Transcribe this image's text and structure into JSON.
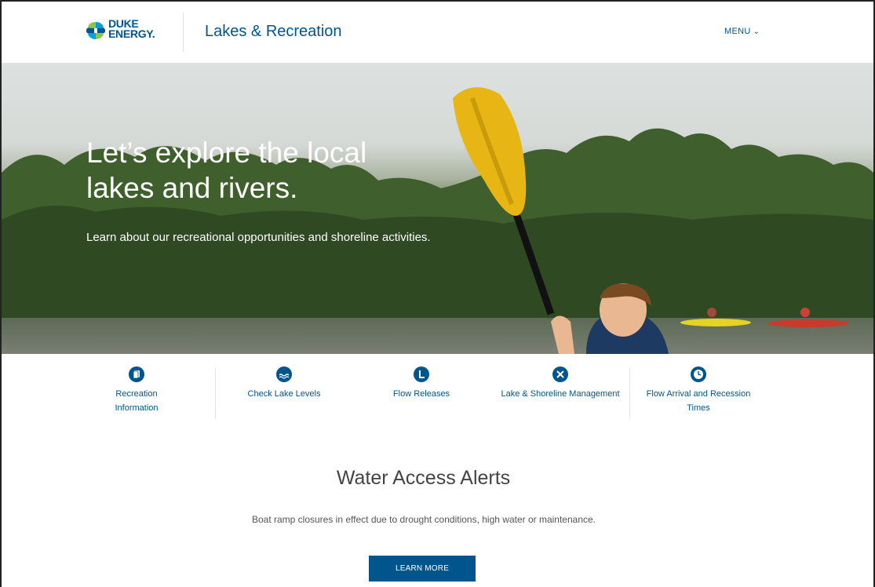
{
  "header": {
    "logo_line1": "DUKE",
    "logo_line2": "ENERGY.",
    "site_title": "Lakes & Recreation",
    "menu_label": "MENU"
  },
  "hero": {
    "heading_line1": "Let’s explore the local",
    "heading_line2": "lakes and rivers.",
    "subtext": "Learn about our recreational opportunities and shoreline activities."
  },
  "quick_links": [
    {
      "label": "Recreation Information",
      "icon": "book-icon"
    },
    {
      "label": "Check Lake Levels",
      "icon": "water-icon"
    },
    {
      "label": "Flow Releases",
      "icon": "flow-icon"
    },
    {
      "label": "Lake & Shoreline Management",
      "icon": "tools-icon"
    },
    {
      "label": "Flow Arrival and Recession Times",
      "icon": "clock-icon"
    }
  ],
  "alerts": {
    "title": "Water Access Alerts",
    "text": "Boat ramp closures in effect due to drought conditions, high water or maintenance.",
    "button_label": "LEARN MORE"
  },
  "colors": {
    "brand_blue": "#00558c",
    "paddle_yellow": "#e8b614"
  }
}
